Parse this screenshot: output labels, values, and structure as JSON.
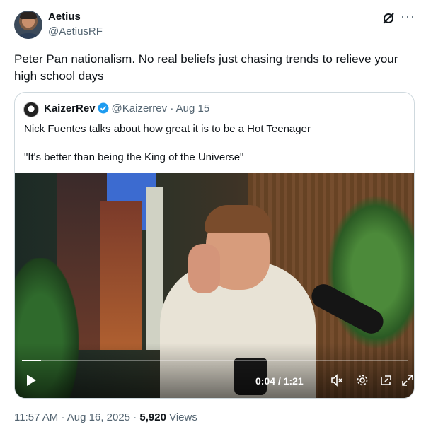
{
  "tweet": {
    "author_name": "Aetius",
    "author_handle": "@AetiusRF",
    "text": "Peter Pan nationalism. No real beliefs just chasing trends to relieve your high school days",
    "time": "11:57 AM",
    "date": "Aug 16, 2025",
    "views_count": "5,920",
    "views_label": "Views",
    "sep": "·"
  },
  "quote": {
    "author_name": "KaizerRev",
    "author_handle": "@Kaizerrev",
    "date": "Aug 15",
    "sep": "·",
    "text_line1": "Nick Fuentes talks about how great it is to be a Hot Teenager",
    "text_line2": "\"It's better than being the King of the Universe\""
  },
  "video": {
    "time_display": "0:04 / 1:21",
    "progress": 0.05,
    "icons": [
      "play-icon",
      "mute-icon",
      "settings-icon",
      "pip-icon",
      "fullscreen-icon"
    ]
  },
  "icons": {
    "grok": "grok-icon",
    "more": "more-icon",
    "verified": "verified-badge-icon"
  },
  "colors": {
    "accent": "#1d9bf0",
    "secondary_text": "#536471",
    "border": "#cfd9de"
  }
}
